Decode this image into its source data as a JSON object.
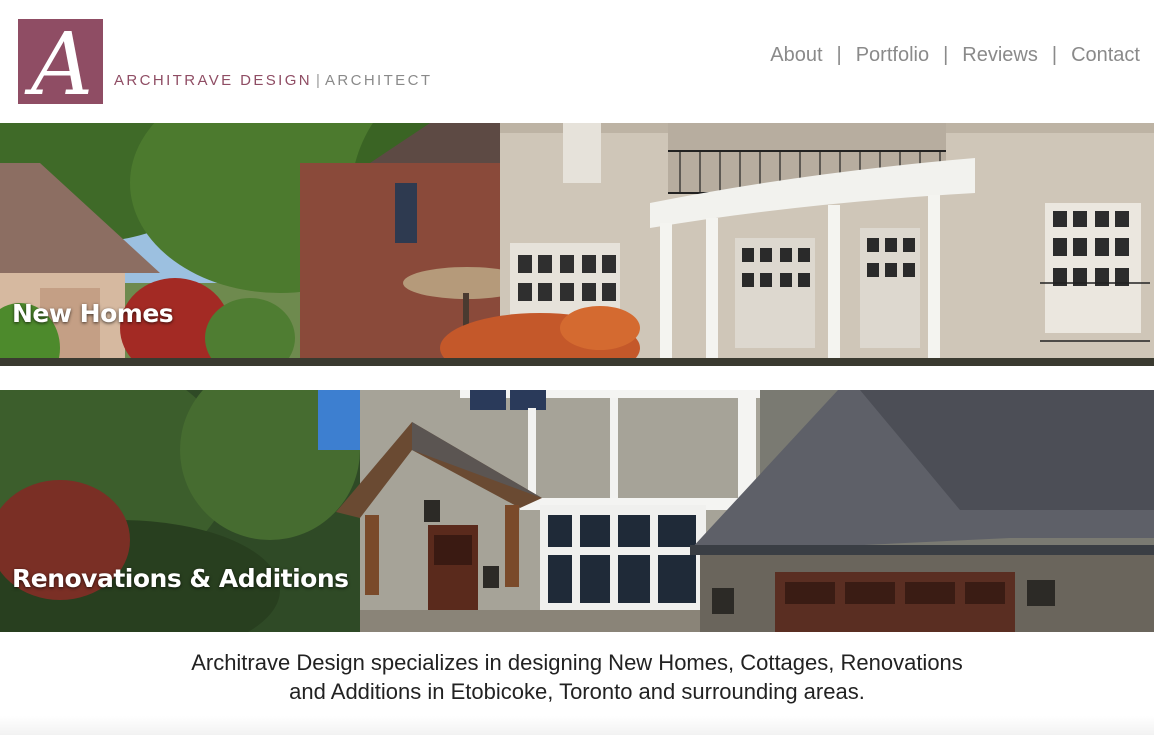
{
  "brand": {
    "logo_letter": "A",
    "name": "ARCHITRAVE DESIGN",
    "separator": "|",
    "role": "ARCHITECT",
    "color": "#8f4d64"
  },
  "nav": {
    "items": [
      {
        "label": "About"
      },
      {
        "label": "Portfolio"
      },
      {
        "label": "Reviews"
      },
      {
        "label": "Contact"
      }
    ],
    "separator": "|"
  },
  "panels": [
    {
      "title": "New Homes"
    },
    {
      "title": "Renovations & Additions"
    }
  ],
  "tagline": {
    "line1": "Architrave Design specializes in designing New Homes, Cottages, Renovations",
    "line2": "and Additions in Etobicoke, Toronto and surrounding areas."
  }
}
